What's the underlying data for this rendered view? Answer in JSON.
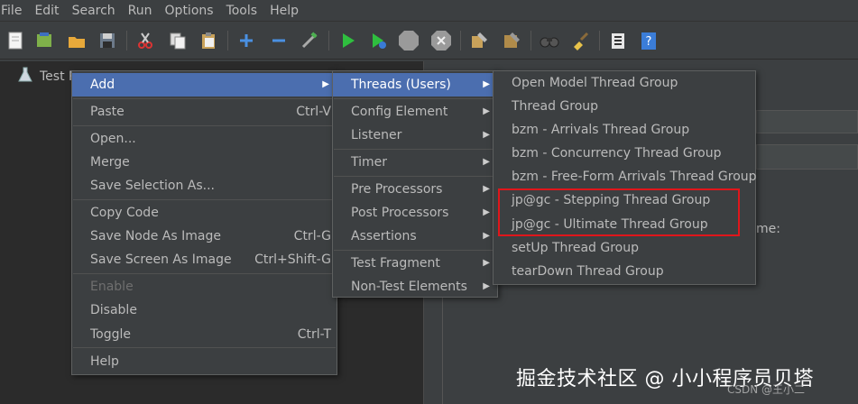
{
  "menubar": [
    "File",
    "Edit",
    "Search",
    "Run",
    "Options",
    "Tools",
    "Help"
  ],
  "tree": {
    "node_label": "Test Pl"
  },
  "context_menu": {
    "items": [
      {
        "label": "Add",
        "submenu": true,
        "highlighted": true
      },
      {
        "label": "Paste",
        "accel": "Ctrl-V"
      },
      {
        "label": "Open..."
      },
      {
        "label": "Merge"
      },
      {
        "label": "Save Selection As..."
      },
      {
        "label": "Copy Code"
      },
      {
        "label": "Save Node As Image",
        "accel": "Ctrl-G"
      },
      {
        "label": "Save Screen As Image",
        "accel": "Ctrl+Shift-G"
      },
      {
        "label": "Enable",
        "disabled": true
      },
      {
        "label": "Disable"
      },
      {
        "label": "Toggle",
        "accel": "Ctrl-T"
      },
      {
        "label": "Help"
      }
    ]
  },
  "add_menu": {
    "items": [
      {
        "label": "Threads (Users)",
        "highlighted": true
      },
      {
        "label": "Config Element"
      },
      {
        "label": "Listener"
      },
      {
        "label": "Timer"
      },
      {
        "label": "Pre Processors"
      },
      {
        "label": "Post Processors"
      },
      {
        "label": "Assertions"
      },
      {
        "label": "Test Fragment"
      },
      {
        "label": "Non-Test Elements"
      }
    ]
  },
  "threads_menu": {
    "items": [
      "Open Model Thread Group",
      "Thread Group",
      "bzm - Arrivals Thread Group",
      "bzm - Concurrency Thread Group",
      "bzm - Free-Form Arrivals Thread Group",
      "jp@gc - Stepping Thread Group",
      "jp@gc - Ultimate Thread Group",
      "setUp Thread Group",
      "tearDown Thread Group"
    ]
  },
  "right_pane": {
    "partial_label": "me:"
  },
  "watermark": {
    "main": "掘金技术社区 @ 小小程序员贝塔",
    "sub": "CSDN @王小二"
  },
  "colors": {
    "highlight": "#4b6eaf",
    "annotation": "#e0161b"
  }
}
